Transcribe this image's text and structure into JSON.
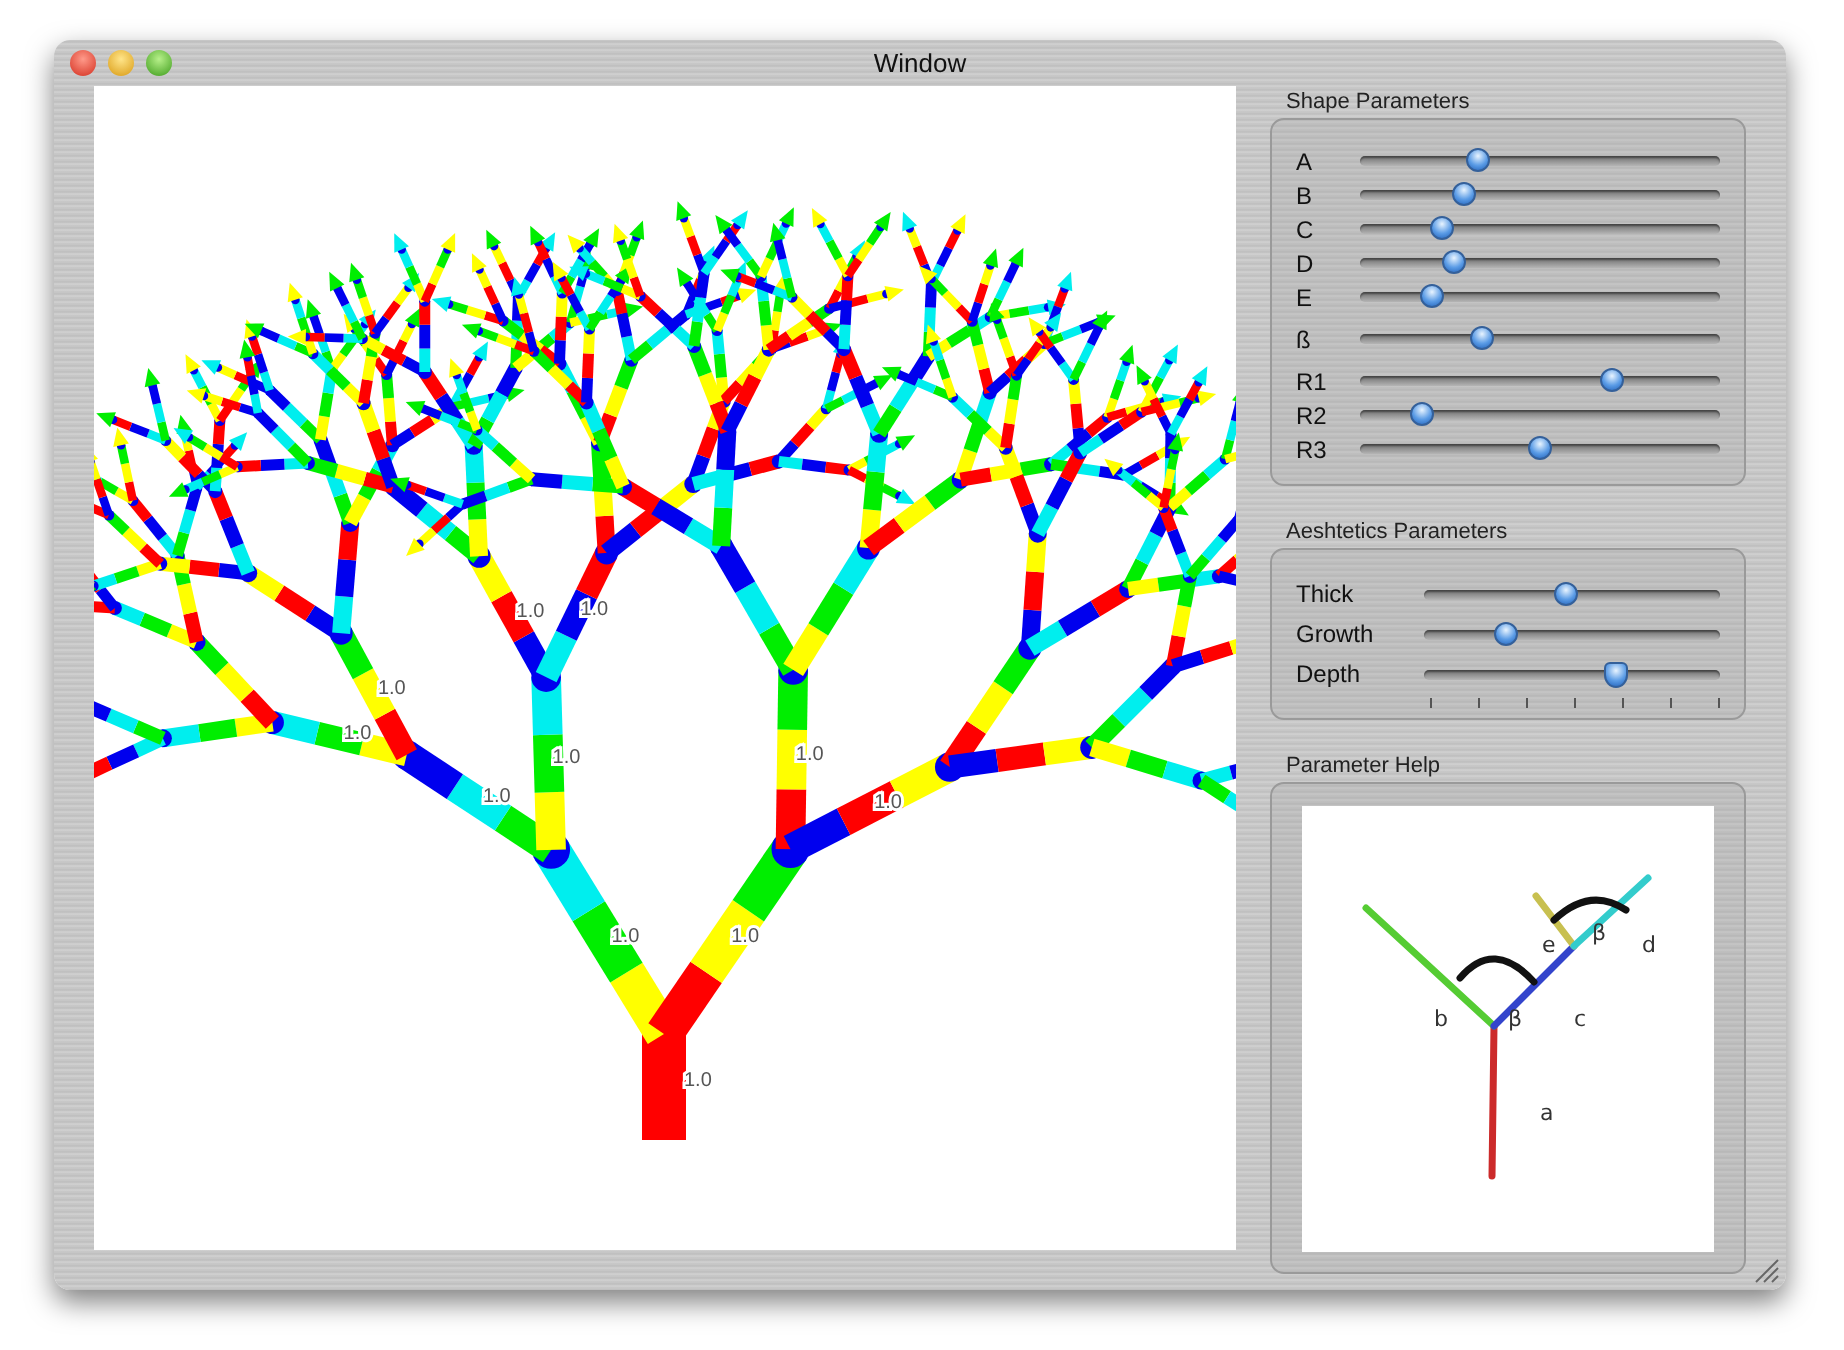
{
  "window": {
    "title": "Window"
  },
  "viewport": {
    "segment_labels": [
      "1.0",
      "1.0",
      "1.0",
      "1.0",
      "1.0",
      "1.0",
      "1.0",
      "1.0",
      "1.0",
      "1.0",
      "1.0"
    ]
  },
  "shape_parameters": {
    "title": "Shape Parameters",
    "sliders": [
      {
        "label": "A",
        "level": 0.33
      },
      {
        "label": "B",
        "level": 0.29
      },
      {
        "label": "C",
        "level": 0.23
      },
      {
        "label": "D",
        "level": 0.26
      },
      {
        "label": "E",
        "level": 0.2
      },
      {
        "label": "ß",
        "level": 0.34
      },
      {
        "label": "R1",
        "level": 0.7
      },
      {
        "label": "R2",
        "level": 0.17
      },
      {
        "label": "R3",
        "level": 0.5
      }
    ]
  },
  "aesthetics_parameters": {
    "title": "Aeshtetics Parameters",
    "sliders": [
      {
        "label": "Thick",
        "kind": "plain",
        "level": 0.48
      },
      {
        "label": "Growth",
        "kind": "plain",
        "level": 0.28
      },
      {
        "label": "Depth",
        "kind": "ticked",
        "level": 0.65
      }
    ]
  },
  "parameter_help": {
    "title": "Parameter Help",
    "diagram_labels": [
      "e",
      "β",
      "d",
      "b",
      "β",
      "c",
      "a"
    ]
  }
}
